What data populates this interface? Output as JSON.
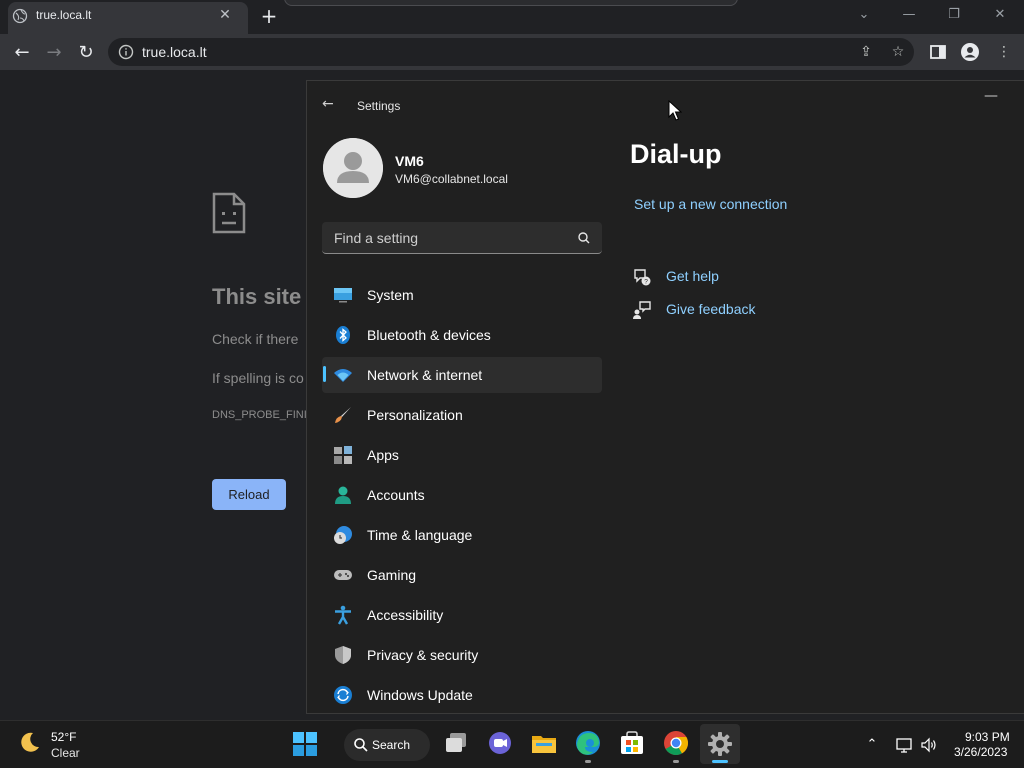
{
  "browser": {
    "tab_title": "true.loca.lt",
    "url": "true.loca.lt"
  },
  "error_page": {
    "title": "This site",
    "line1": "Check if there",
    "line2": "If spelling is co",
    "code": "DNS_PROBE_FINIS",
    "reload_label": "Reload"
  },
  "settings": {
    "window_title": "Settings",
    "user": {
      "name": "VM6",
      "email": "VM6@collabnet.local"
    },
    "search_placeholder": "Find a setting",
    "nav": [
      {
        "label": "System",
        "icon": "system-icon"
      },
      {
        "label": "Bluetooth & devices",
        "icon": "bluetooth-icon"
      },
      {
        "label": "Network & internet",
        "icon": "wifi-icon",
        "selected": true
      },
      {
        "label": "Personalization",
        "icon": "brush-icon"
      },
      {
        "label": "Apps",
        "icon": "apps-icon"
      },
      {
        "label": "Accounts",
        "icon": "person-icon"
      },
      {
        "label": "Time & language",
        "icon": "globe-clock-icon"
      },
      {
        "label": "Gaming",
        "icon": "gamepad-icon"
      },
      {
        "label": "Accessibility",
        "icon": "accessibility-icon"
      },
      {
        "label": "Privacy & security",
        "icon": "shield-icon"
      },
      {
        "label": "Windows Update",
        "icon": "update-icon"
      }
    ],
    "page": {
      "title": "Dial-up",
      "setup_link": "Set up a new connection",
      "help_label": "Get help",
      "feedback_label": "Give feedback"
    },
    "accent_color": "#4cc2ff",
    "link_color": "#8fd0ff"
  },
  "taskbar": {
    "weather_temp": "52°F",
    "weather_condition": "Clear",
    "search_label": "Search",
    "time": "9:03 PM",
    "date": "3/26/2023"
  }
}
